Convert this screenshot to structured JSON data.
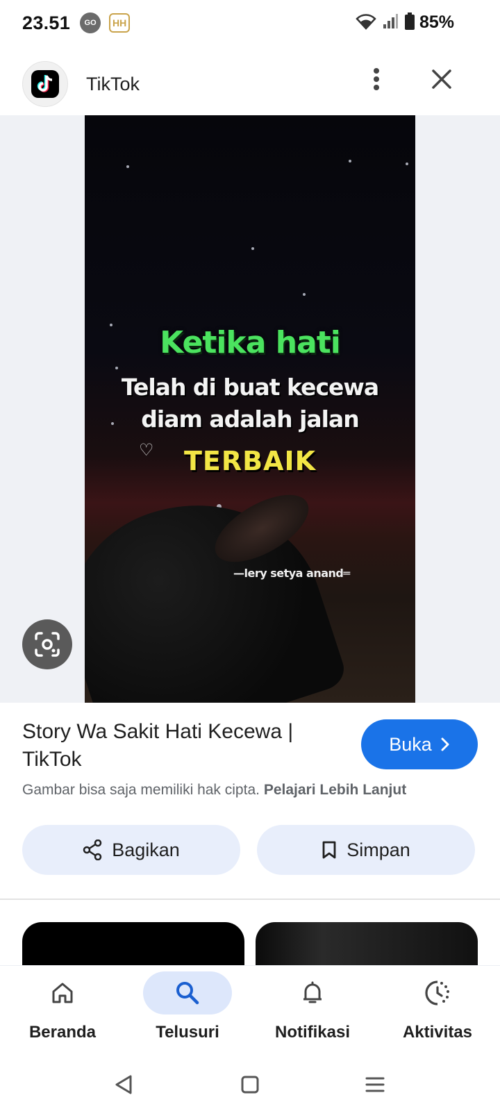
{
  "status_bar": {
    "time": "23.51",
    "go_badge": "GO",
    "hh_badge": "HH",
    "battery": "85%",
    "icons": [
      "wifi-icon",
      "signal-icon",
      "battery-icon"
    ]
  },
  "header": {
    "app_name": "TikTok",
    "logo_icon": "tiktok-logo-icon",
    "more_icon": "more-vert-icon",
    "close_icon": "close-icon"
  },
  "preview": {
    "lines": [
      "Ketika hati",
      "Telah di buat kecewa",
      "diam adalah jalan",
      "TERBAIK"
    ],
    "watermark": "—lery setya anand═",
    "lens_icon": "lens-icon"
  },
  "result": {
    "title": "Story Wa Sakit Hati Kecewa | TikTok",
    "open_label": "Buka",
    "copyright_text": "Gambar bisa saja memiliki hak cipta.",
    "learn_more": "Pelajari Lebih Lanjut"
  },
  "actions": {
    "share_label": "Bagikan",
    "save_label": "Simpan"
  },
  "bottom_nav": {
    "items": [
      {
        "label": "Beranda",
        "icon": "home-icon",
        "active": false
      },
      {
        "label": "Telusuri",
        "icon": "search-icon",
        "active": true
      },
      {
        "label": "Notifikasi",
        "icon": "bell-icon",
        "active": false
      },
      {
        "label": "Aktivitas",
        "icon": "activity-icon",
        "active": false
      }
    ]
  },
  "colors": {
    "accent": "#1a73e8",
    "pill_bg": "#e8eefb",
    "nav_active_bg": "#dde7fb",
    "green_text": "#4be35f",
    "yellow_text": "#f3e645"
  }
}
